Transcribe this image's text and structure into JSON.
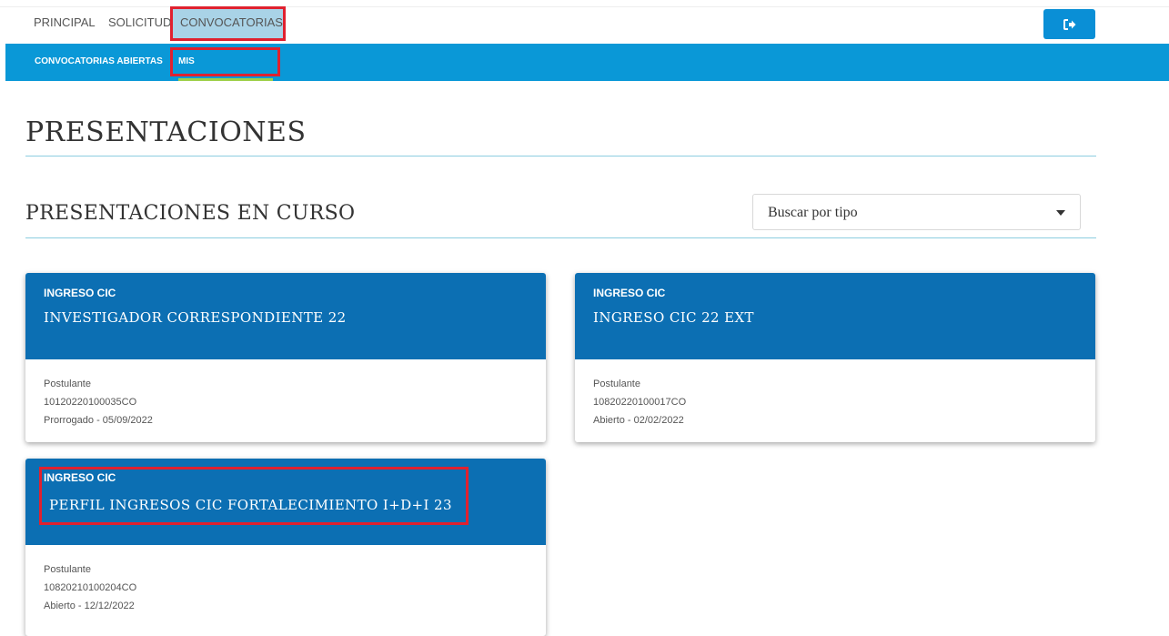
{
  "nav": {
    "items": [
      {
        "label": "PRINCIPAL"
      },
      {
        "label": "SOLICITUD"
      },
      {
        "label": "CONVOCATORIAS"
      }
    ],
    "logout_icon": "sign-out-icon"
  },
  "subnav": {
    "items": [
      {
        "label": "CONVOCATORIAS ABIERTAS"
      },
      {
        "label": "MIS POSTULACIONES"
      }
    ]
  },
  "page": {
    "title": "PRESENTACIONES",
    "section_title": "PRESENTACIONES EN CURSO",
    "filter": {
      "selected": "Buscar por tipo"
    }
  },
  "cards": [
    {
      "kind": "INGRESO CIC",
      "title": "INVESTIGADOR CORRESPONDIENTE 22",
      "role": "Postulante",
      "code": "10120220100035CO",
      "status": "Prorrogado - 05/09/2022"
    },
    {
      "kind": "INGRESO CIC",
      "title": "INGRESO CIC 22 EXT",
      "role": "Postulante",
      "code": "10820220100017CO",
      "status": "Abierto - 02/02/2022"
    },
    {
      "kind": "INGRESO CIC",
      "title": "PERFIL INGRESOS CIC FORTALECIMIENTO I+D+I 23",
      "role": "Postulante",
      "code": "10820210100204CO",
      "status": "Abierto - 12/12/2022"
    }
  ],
  "colors": {
    "primary": "#0c6fb3",
    "subnav": "#0a98d7",
    "active_tab": "#a9d3e7",
    "highlight": "#e0212f"
  }
}
